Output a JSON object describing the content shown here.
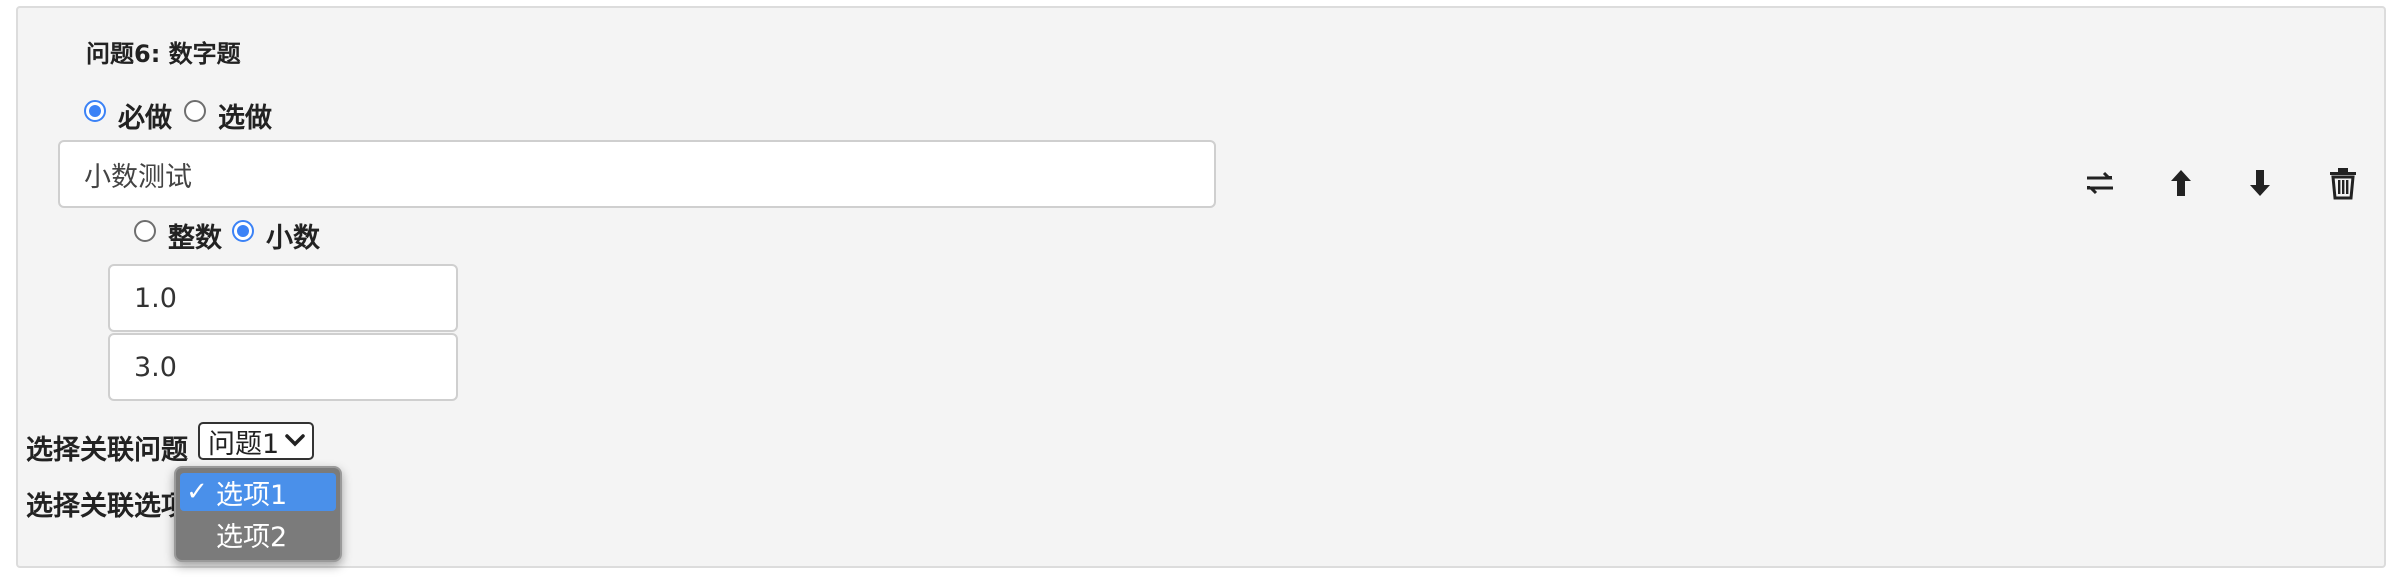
{
  "question": {
    "title": "问题6: 数字题",
    "required_label": "必做",
    "optional_label": "选做",
    "required_selected": true,
    "text_value": "小数测试",
    "number_type": {
      "integer_label": "整数",
      "decimal_label": "小数",
      "decimal_selected": true
    },
    "min_value": "1.0",
    "max_value": "3.0"
  },
  "actions": {
    "icons": [
      "swap-icon",
      "arrow-up-icon",
      "arrow-down-icon",
      "trash-icon"
    ]
  },
  "link": {
    "question_label": "选择关联问题",
    "question_selected": "问题1",
    "option_label": "选择关联选项",
    "dropdown_options": [
      {
        "label": "选项1",
        "checked": true
      },
      {
        "label": "选项2",
        "checked": false
      }
    ]
  },
  "colors": {
    "accent": "#3b82f6",
    "dropdown_highlight": "#4a90ea",
    "panel_bg": "#f4f4f4"
  }
}
